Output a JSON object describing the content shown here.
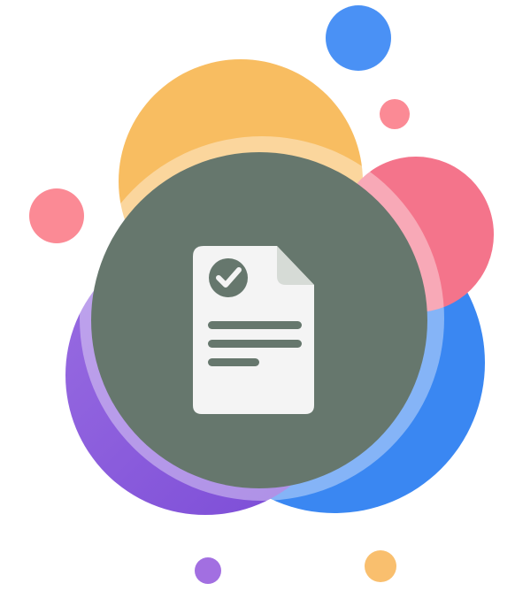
{
  "illustration": {
    "icon": "document-check-icon",
    "colors": {
      "background": "#ffffff",
      "blue": "#3d8ef8",
      "orange": "#f9be5d",
      "pink": "#fe808c",
      "purple": "#8c5cdc",
      "violet": "#a57ad8",
      "center_circle": "#66776d",
      "document": "#f4f4f4"
    }
  }
}
